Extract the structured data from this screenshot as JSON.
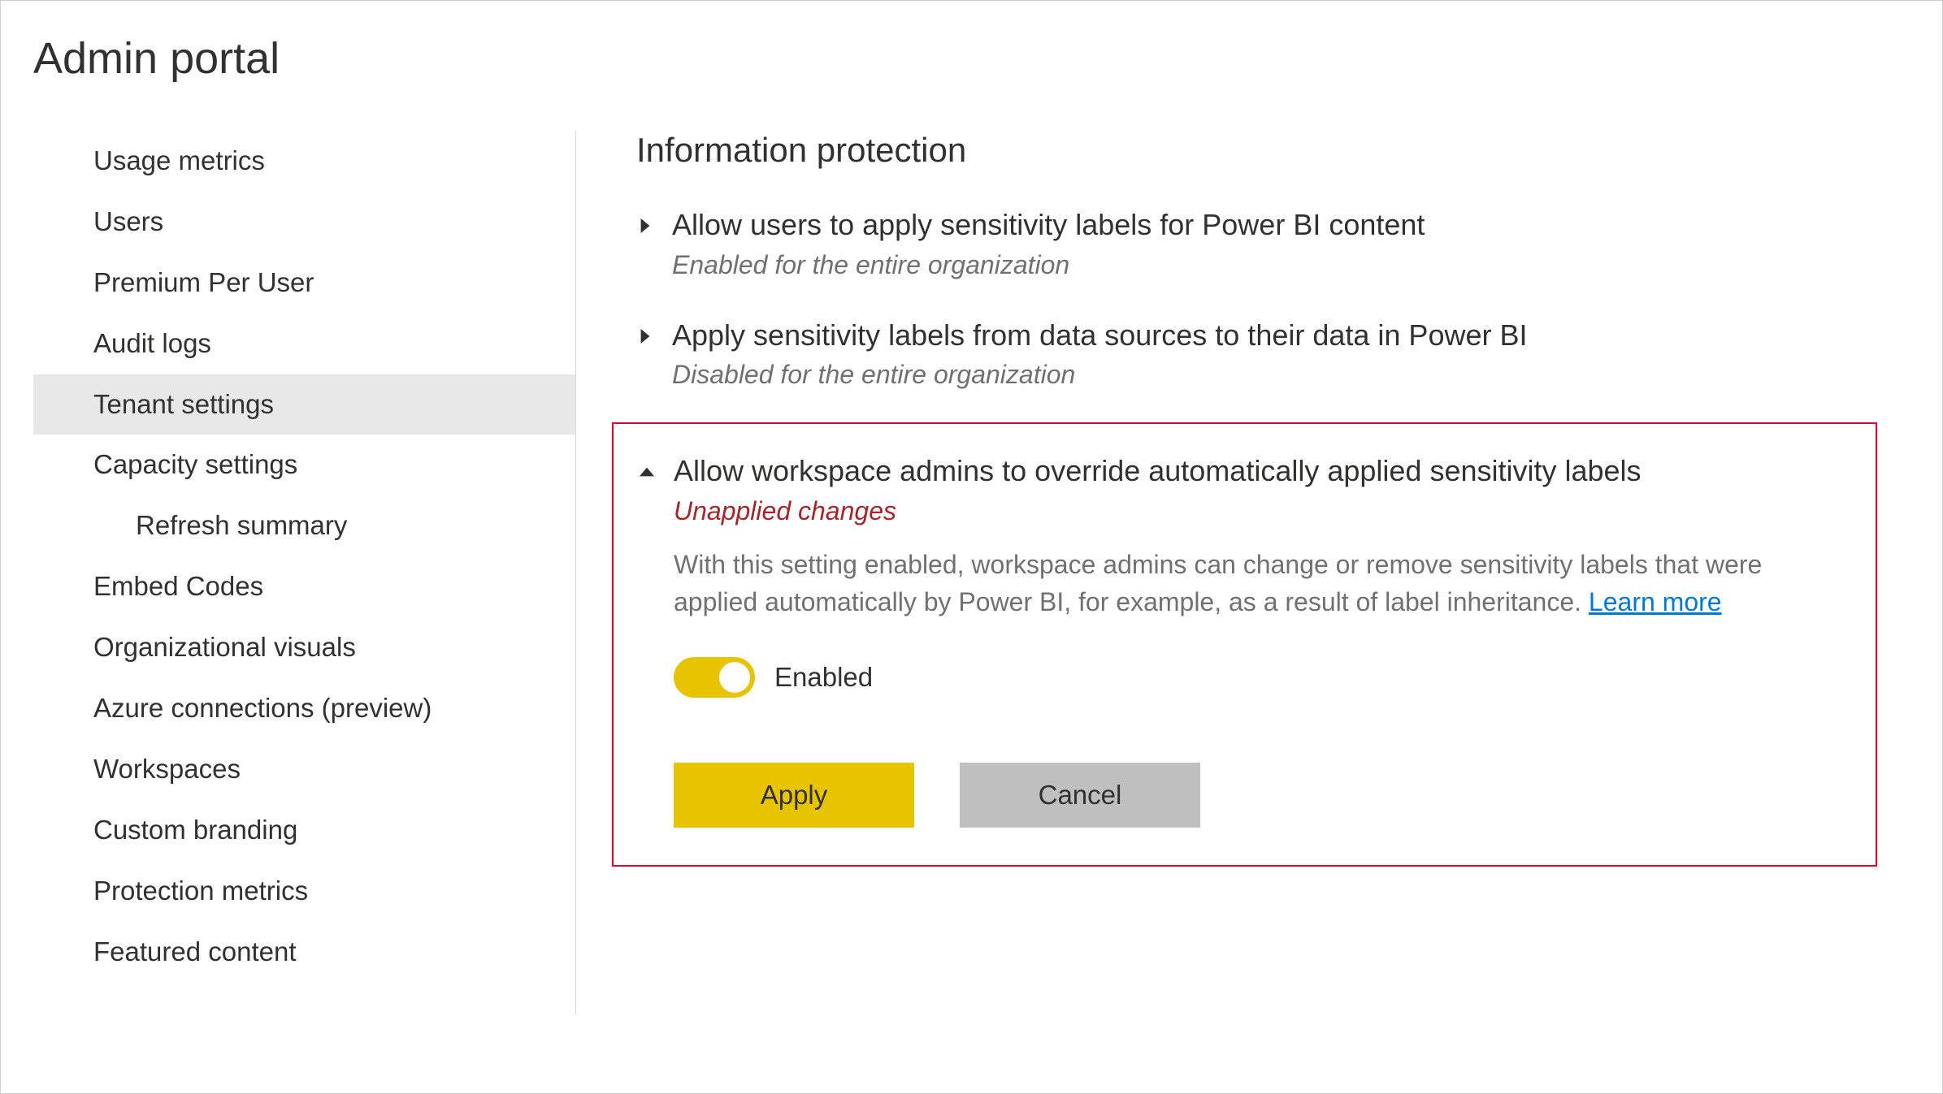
{
  "page_title": "Admin portal",
  "sidebar": {
    "items": [
      {
        "label": "Usage metrics",
        "selected": false,
        "indent": false
      },
      {
        "label": "Users",
        "selected": false,
        "indent": false
      },
      {
        "label": "Premium Per User",
        "selected": false,
        "indent": false
      },
      {
        "label": "Audit logs",
        "selected": false,
        "indent": false
      },
      {
        "label": "Tenant settings",
        "selected": true,
        "indent": false
      },
      {
        "label": "Capacity settings",
        "selected": false,
        "indent": false
      },
      {
        "label": "Refresh summary",
        "selected": false,
        "indent": true
      },
      {
        "label": "Embed Codes",
        "selected": false,
        "indent": false
      },
      {
        "label": "Organizational visuals",
        "selected": false,
        "indent": false
      },
      {
        "label": "Azure connections (preview)",
        "selected": false,
        "indent": false
      },
      {
        "label": "Workspaces",
        "selected": false,
        "indent": false
      },
      {
        "label": "Custom branding",
        "selected": false,
        "indent": false
      },
      {
        "label": "Protection metrics",
        "selected": false,
        "indent": false
      },
      {
        "label": "Featured content",
        "selected": false,
        "indent": false
      }
    ]
  },
  "content": {
    "section_heading": "Information protection",
    "settings": [
      {
        "title": "Allow users to apply sensitivity labels for Power BI content",
        "status": "Enabled for the entire organization",
        "expanded": false
      },
      {
        "title": "Apply sensitivity labels from data sources to their data in Power BI",
        "status": "Disabled for the entire organization",
        "expanded": false
      },
      {
        "title": "Allow workspace admins to override automatically applied sensitivity labels",
        "status": "Unapplied changes",
        "status_kind": "unapplied",
        "expanded": true,
        "highlighted": true,
        "description": "With this setting enabled, workspace admins can change or remove sensitivity labels that were applied automatically by Power BI, for example, as a result of label inheritance.",
        "learn_more": "Learn more",
        "toggle": {
          "on": true,
          "label": "Enabled"
        },
        "buttons": {
          "apply": "Apply",
          "cancel": "Cancel"
        }
      }
    ]
  }
}
